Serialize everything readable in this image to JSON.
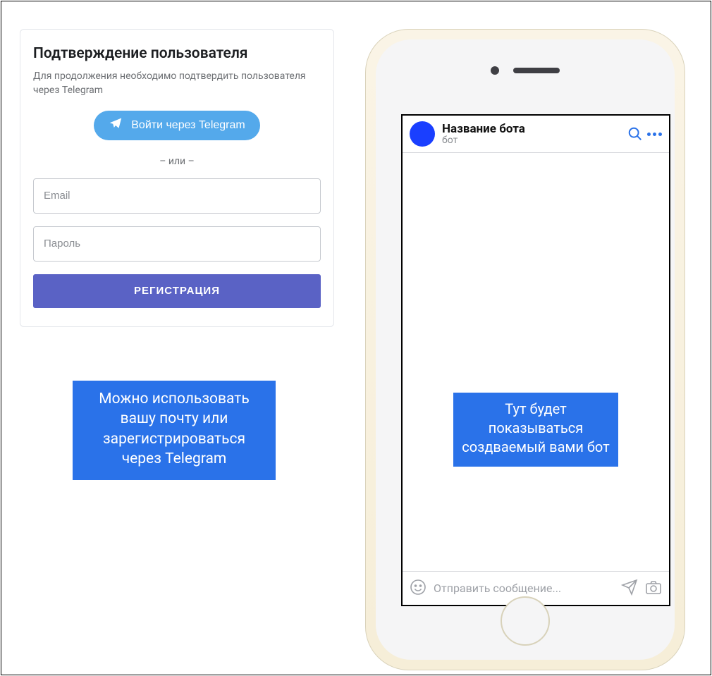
{
  "card": {
    "title": "Подтверждение пользователя",
    "subtitle": "Для продолжения необходимо подтвердить пользователя через Telegram",
    "telegram_button": "Войти через Telegram",
    "or_separator": "– или –",
    "email_placeholder": "Email",
    "password_placeholder": "Пароль",
    "register_button": "РЕГИСТРАЦИЯ"
  },
  "callout_left": "Можно использовать вашу почту или зарегистрироваться через Telegram",
  "phone": {
    "bot_name": "Название бота",
    "bot_sub": "бот",
    "callout": "Тут будет показываться создваемый вами бот",
    "input_placeholder": "Отправить сообщение..."
  },
  "colors": {
    "accent_blue": "#2a72e9",
    "telegram_blue": "#54a9eb",
    "register_purple": "#5a62c5"
  }
}
